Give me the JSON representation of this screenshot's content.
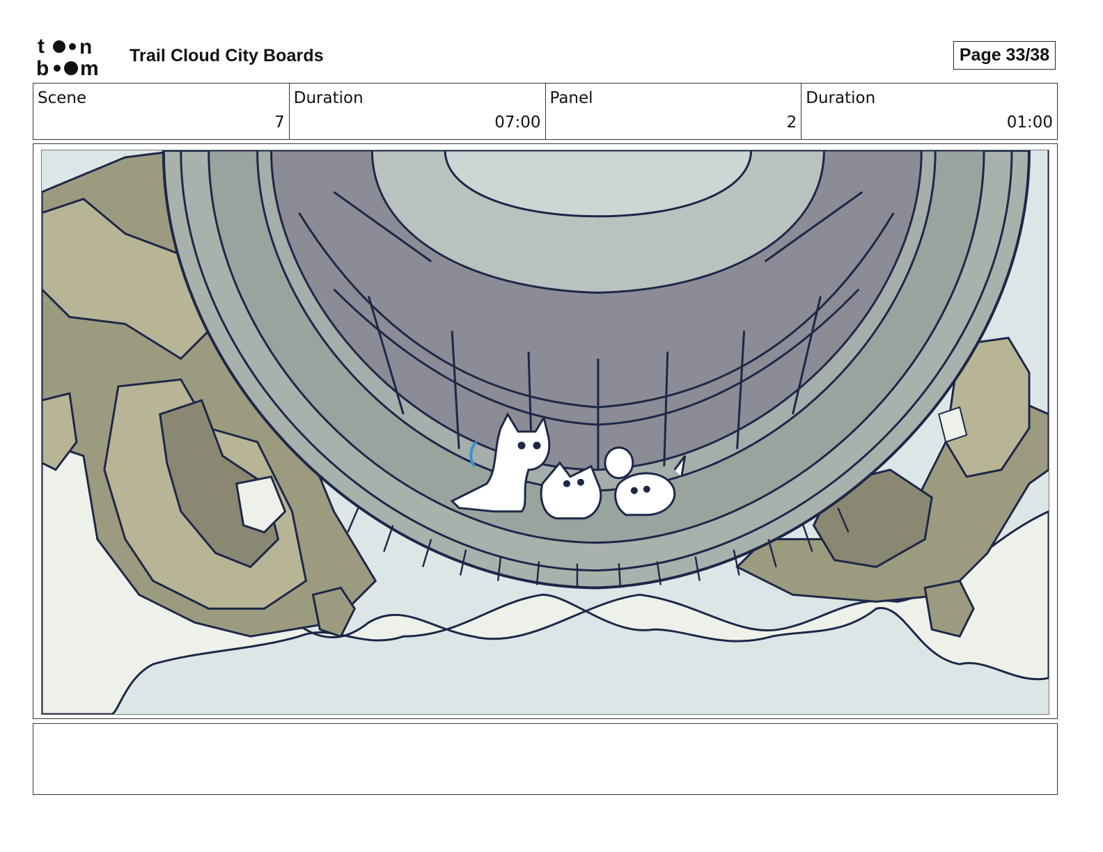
{
  "header": {
    "logo_text": "toon boom",
    "title": "Trail Cloud City Boards",
    "page_label": "Page 33/38"
  },
  "info": {
    "scene_label": "Scene",
    "scene_value": "7",
    "scene_duration_label": "Duration",
    "scene_duration_value": "07:00",
    "panel_label": "Panel",
    "panel_value": "2",
    "panel_duration_label": "Duration",
    "panel_duration_value": "01:00"
  },
  "panel": {
    "image_subject": "storyboard-drawing-stone-city-platform-with-cat-fox-dog"
  },
  "caption": {
    "text": ""
  },
  "colors": {
    "sky": "#dde6e6",
    "cloud": "#eef1ea",
    "rock_light": "#b7b596",
    "rock_mid": "#9c9b80",
    "rock_dark": "#8a8872",
    "stone_ring": "#a9b1ac",
    "inner_tile": "#8c8c96",
    "center_light": "#cdd6d4",
    "ink": "#1d2747"
  }
}
